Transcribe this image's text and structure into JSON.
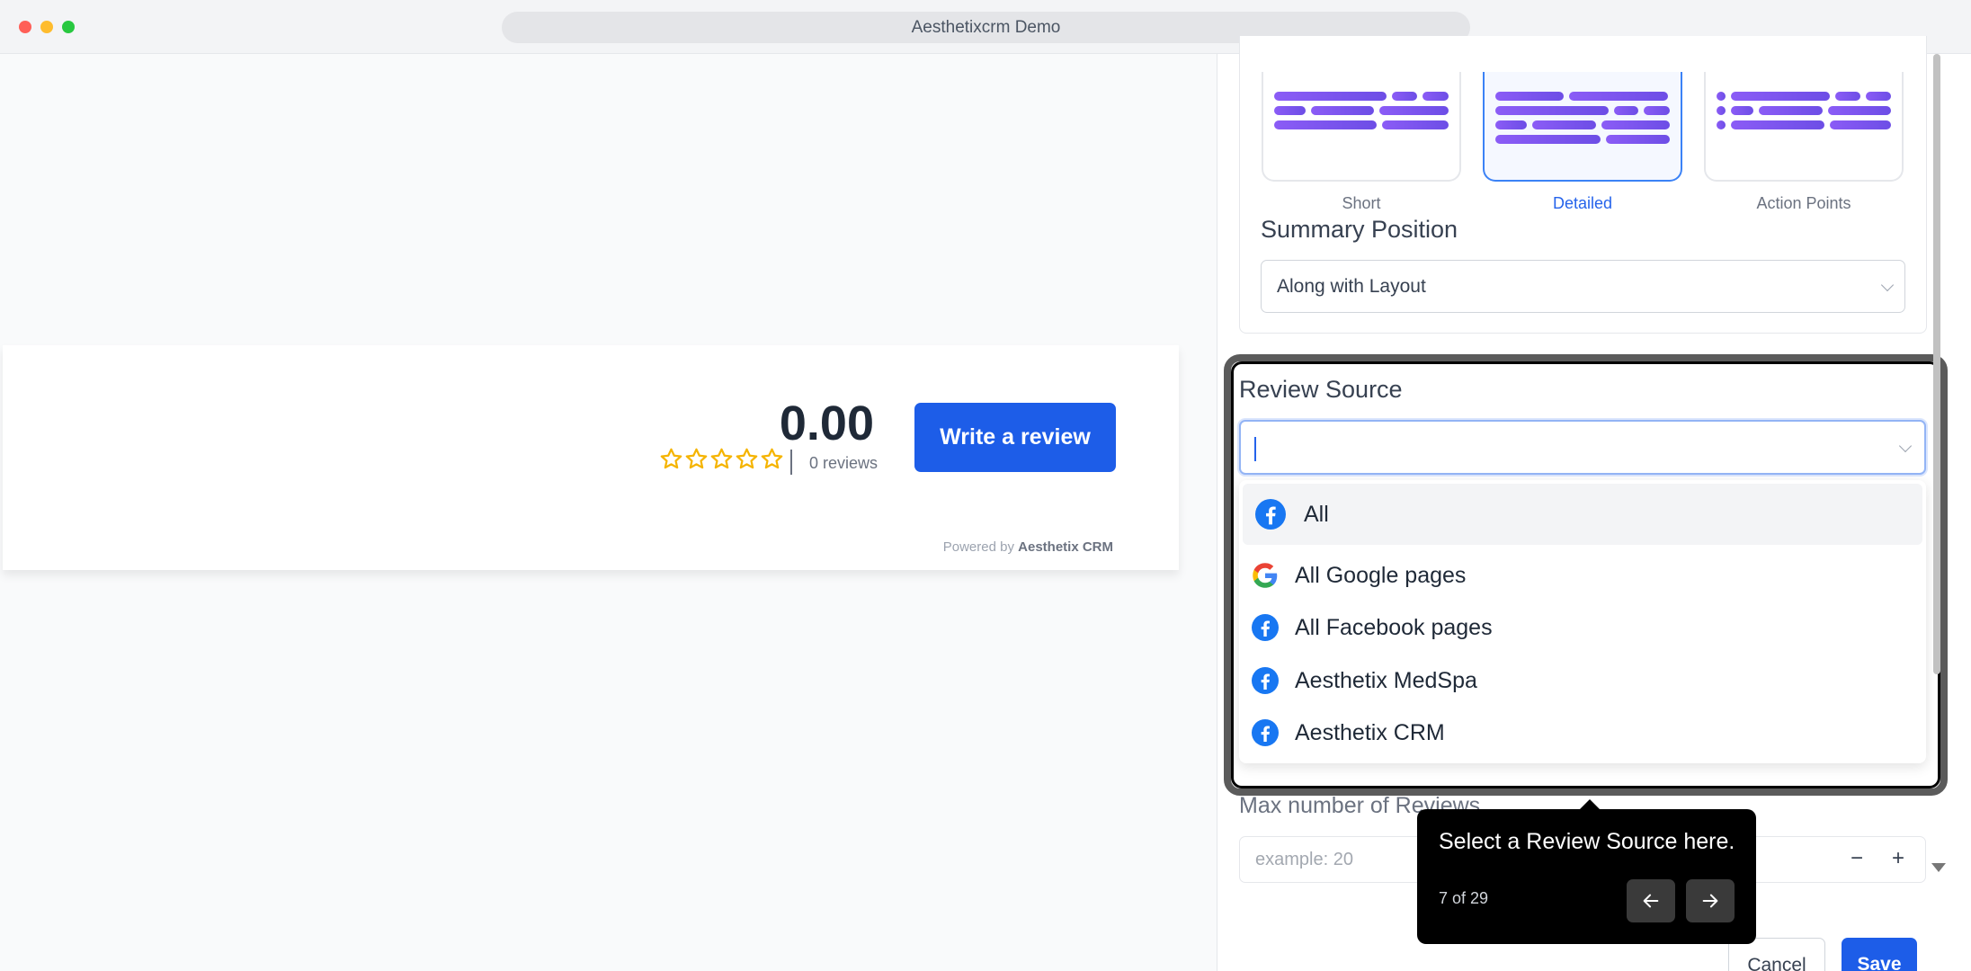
{
  "window": {
    "title": "Aesthetixcrm Demo"
  },
  "preview": {
    "rating": "0.00",
    "reviews_count": "0 reviews",
    "write_review_label": "Write a review",
    "powered_prefix": "Powered by ",
    "powered_brand": "Aesthetix CRM",
    "star_color": "#f5b400"
  },
  "layout_options": [
    {
      "label": "Short",
      "selected": false
    },
    {
      "label": "Detailed",
      "selected": true
    },
    {
      "label": "Action Points",
      "selected": false
    }
  ],
  "summary_position": {
    "title": "Summary Position",
    "value": "Along with Layout"
  },
  "review_source": {
    "title": "Review Source",
    "value": "",
    "options": [
      {
        "label": "All",
        "icon": "facebook-icon"
      },
      {
        "label": "All Google pages",
        "icon": "google-icon"
      },
      {
        "label": "All Facebook pages",
        "icon": "facebook-icon"
      },
      {
        "label": "Aesthetix MedSpa",
        "icon": "facebook-icon"
      },
      {
        "label": "Aesthetix CRM",
        "icon": "facebook-icon"
      }
    ]
  },
  "max_reviews": {
    "label": "Max number of Reviews",
    "placeholder": "example: 20",
    "minus": "−",
    "plus": "+"
  },
  "actions": {
    "cancel": "Cancel",
    "save": "Save"
  },
  "tour": {
    "text": "Select a Review Source here.",
    "step": "7 of 29",
    "current": 7,
    "total": 29
  },
  "colors": {
    "accent": "#1d5de8",
    "facebook": "#1877f2"
  }
}
